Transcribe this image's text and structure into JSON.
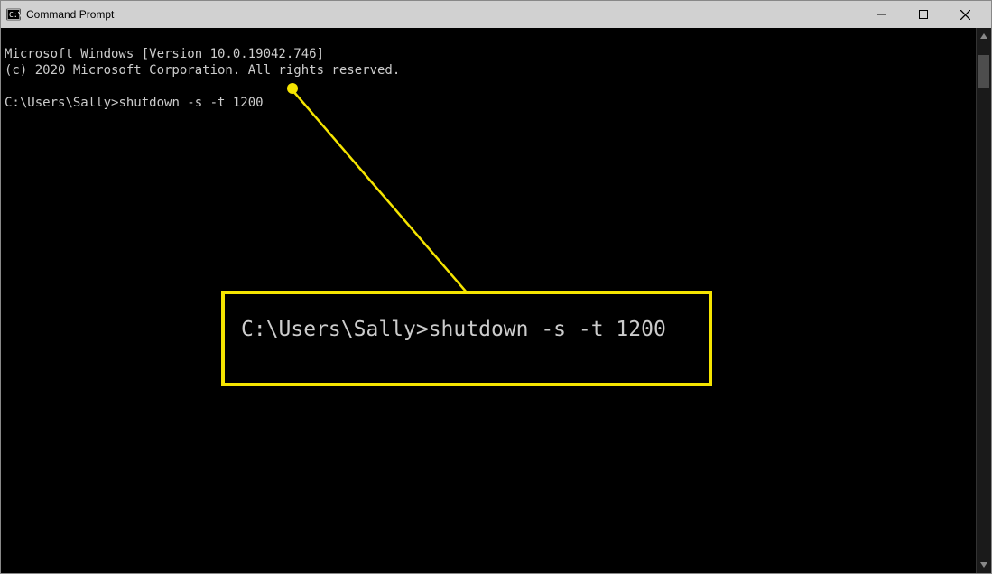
{
  "window": {
    "title": "Command Prompt"
  },
  "terminal": {
    "line1": "Microsoft Windows [Version 10.0.19042.746]",
    "line2": "(c) 2020 Microsoft Corporation. All rights reserved.",
    "blank": "",
    "prompt_prefix": "C:\\Users\\Sally>",
    "command": "shutdown -s -t 1200"
  },
  "callout": {
    "text": "C:\\Users\\Sally>shutdown -s -t 1200"
  }
}
